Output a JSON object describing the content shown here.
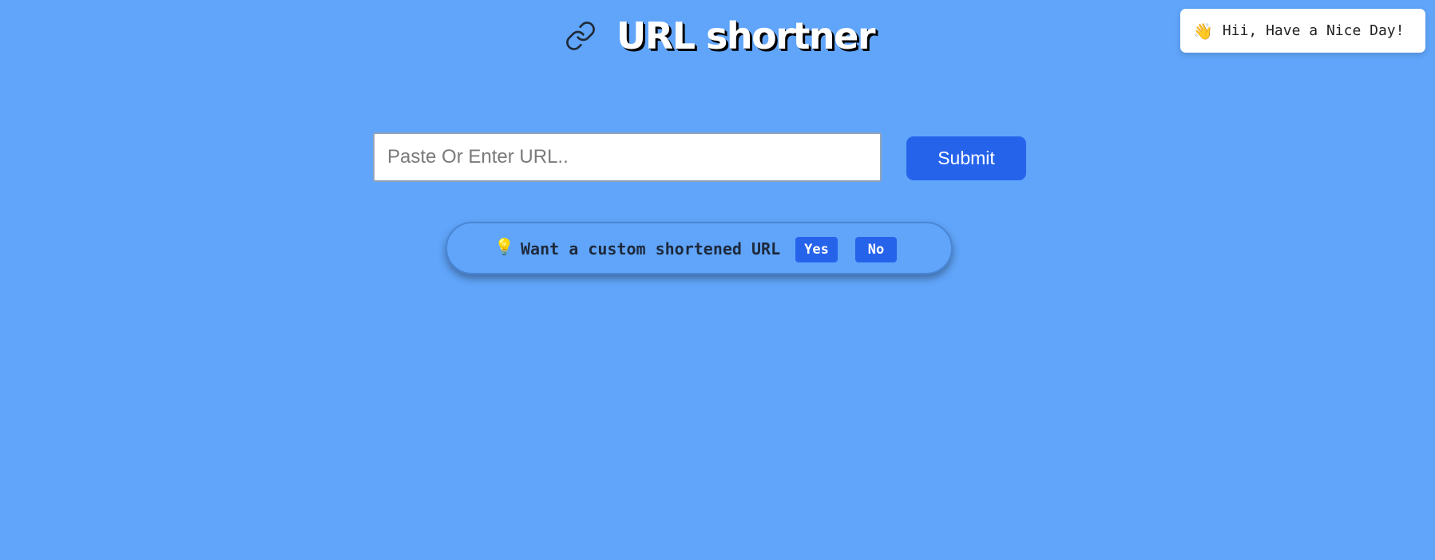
{
  "header": {
    "title": "URL shortner",
    "icon": "link-icon"
  },
  "toast": {
    "icon": "waving-hand-icon",
    "icon_glyph": "👋",
    "text": "Hii, Have a Nice Day!"
  },
  "form": {
    "url_input": {
      "placeholder": "Paste Or Enter URL..",
      "value": ""
    },
    "submit_label": "Submit"
  },
  "custom_prompt": {
    "icon": "lightbulb-icon",
    "icon_glyph": "💡",
    "text": "Want a custom shortened URL",
    "yes_label": "Yes",
    "no_label": "No"
  },
  "colors": {
    "background": "#60a5fa",
    "accent": "#2563eb",
    "title_text": "#ffffff",
    "toast_background": "#ffffff"
  }
}
